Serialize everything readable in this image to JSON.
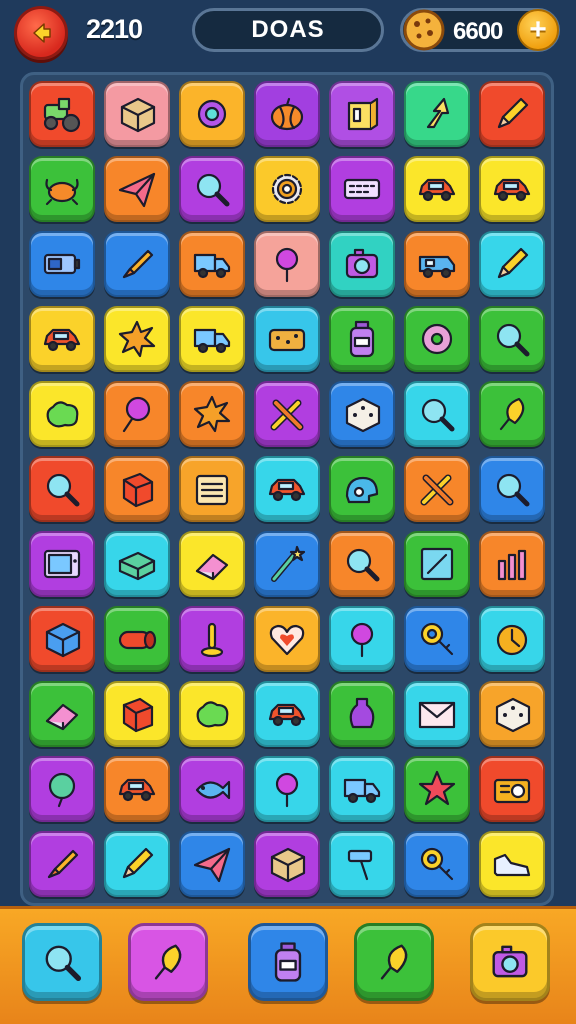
{
  "header": {
    "score": "2210",
    "title": "DOAS",
    "coins": "6600",
    "plus": "+"
  },
  "board": {
    "rows": [
      [
        {
          "color": "#f04a2c",
          "icon": "tractor-icon"
        },
        {
          "color": "#f49aa2",
          "icon": "box-icon"
        },
        {
          "color": "#fbb42a",
          "icon": "ring-icon"
        },
        {
          "color": "#a23fe0",
          "icon": "pumpkin-icon"
        },
        {
          "color": "#b04fe4",
          "icon": "book-box-icon"
        },
        {
          "color": "#37d88a",
          "icon": "arrow-icon"
        },
        {
          "color": "#f04a2c",
          "icon": "pencil-icon"
        }
      ],
      [
        {
          "color": "#3cc13a",
          "icon": "crab-icon"
        },
        {
          "color": "#f7862a",
          "icon": "paper-plane-icon"
        },
        {
          "color": "#b13ee0",
          "icon": "magnifier-icon"
        },
        {
          "color": "#fbc92a",
          "icon": "gear-icon"
        },
        {
          "color": "#b13ee0",
          "icon": "keyboard-icon"
        },
        {
          "color": "#fbe62a",
          "icon": "car-icon"
        },
        {
          "color": "#fbe62a",
          "icon": "car-icon"
        }
      ],
      [
        {
          "color": "#2f86e8",
          "icon": "battery-icon"
        },
        {
          "color": "#2f86e8",
          "icon": "crayon-icon"
        },
        {
          "color": "#f7862a",
          "icon": "truck-icon"
        },
        {
          "color": "#f5a39a",
          "icon": "pin-icon"
        },
        {
          "color": "#31d2c2",
          "icon": "camera-icon"
        },
        {
          "color": "#f7862a",
          "icon": "van-icon"
        },
        {
          "color": "#37d6ea",
          "icon": "pencil-icon"
        }
      ],
      [
        {
          "color": "#fbd22a",
          "icon": "car-icon"
        },
        {
          "color": "#fbe62a",
          "icon": "splash-icon"
        },
        {
          "color": "#fbe62a",
          "icon": "truck-icon"
        },
        {
          "color": "#37c6ea",
          "icon": "sponge-icon"
        },
        {
          "color": "#3cc13a",
          "icon": "bottle-icon"
        },
        {
          "color": "#3cc13a",
          "icon": "donut-icon"
        },
        {
          "color": "#3cc13a",
          "icon": "magnifier-icon"
        }
      ],
      [
        {
          "color": "#fbe62a",
          "icon": "blob-icon"
        },
        {
          "color": "#f7862a",
          "icon": "lollipop-icon"
        },
        {
          "color": "#f7862a",
          "icon": "splash-icon"
        },
        {
          "color": "#b13ee0",
          "icon": "tools-icon"
        },
        {
          "color": "#2f86e8",
          "icon": "dice-icon"
        },
        {
          "color": "#37d6ea",
          "icon": "magnifier-icon"
        },
        {
          "color": "#3cc13a",
          "icon": "brush-icon"
        }
      ],
      [
        {
          "color": "#f04a2c",
          "icon": "magnifier-icon"
        },
        {
          "color": "#f7862a",
          "icon": "cube-icon"
        },
        {
          "color": "#f7a42a",
          "icon": "notepad-icon"
        },
        {
          "color": "#37d6ea",
          "icon": "car-icon"
        },
        {
          "color": "#3cc13a",
          "icon": "helmet-icon"
        },
        {
          "color": "#f7862a",
          "icon": "tools-icon"
        },
        {
          "color": "#2f86e8",
          "icon": "magnifier-icon"
        }
      ],
      [
        {
          "color": "#b13ee0",
          "icon": "tv-icon"
        },
        {
          "color": "#37d6ea",
          "icon": "book-icon"
        },
        {
          "color": "#fbe62a",
          "icon": "eraser-icon"
        },
        {
          "color": "#2f86e8",
          "icon": "wand-icon"
        },
        {
          "color": "#f7862a",
          "icon": "magnifier-icon"
        },
        {
          "color": "#3cc13a",
          "icon": "frame-icon"
        },
        {
          "color": "#f7862a",
          "icon": "chart-icon"
        }
      ],
      [
        {
          "color": "#f04a2c",
          "icon": "gem-icon"
        },
        {
          "color": "#3cc13a",
          "icon": "pipe-icon"
        },
        {
          "color": "#b13ee0",
          "icon": "peg-icon"
        },
        {
          "color": "#fbb42a",
          "icon": "heart-icon"
        },
        {
          "color": "#37d6ea",
          "icon": "pin-icon"
        },
        {
          "color": "#2f86e8",
          "icon": "key-icon"
        },
        {
          "color": "#37d6ea",
          "icon": "clock-icon"
        }
      ],
      [
        {
          "color": "#3cc13a",
          "icon": "eraser-icon"
        },
        {
          "color": "#fbe62a",
          "icon": "cube-icon"
        },
        {
          "color": "#fbe62a",
          "icon": "blob-icon"
        },
        {
          "color": "#37d6ea",
          "icon": "car-icon"
        },
        {
          "color": "#3cc13a",
          "icon": "vase-icon"
        },
        {
          "color": "#37d6ea",
          "icon": "envelope-icon"
        },
        {
          "color": "#f7a42a",
          "icon": "dice-icon"
        }
      ],
      [
        {
          "color": "#b13ee0",
          "icon": "balloon-icon"
        },
        {
          "color": "#f7862a",
          "icon": "car-icon"
        },
        {
          "color": "#b13ee0",
          "icon": "fish-icon"
        },
        {
          "color": "#37d6ea",
          "icon": "pin-icon"
        },
        {
          "color": "#37d6ea",
          "icon": "truck-icon"
        },
        {
          "color": "#3cc13a",
          "icon": "star-icon"
        },
        {
          "color": "#f04a2c",
          "icon": "radio-icon"
        }
      ],
      [
        {
          "color": "#b13ee0",
          "icon": "crayon-icon"
        },
        {
          "color": "#37d6ea",
          "icon": "pencil-icon"
        },
        {
          "color": "#2f86e8",
          "icon": "paper-plane-icon"
        },
        {
          "color": "#b13ee0",
          "icon": "box-icon"
        },
        {
          "color": "#37d6ea",
          "icon": "hammer-icon"
        },
        {
          "color": "#2f86e8",
          "icon": "key-icon"
        },
        {
          "color": "#fbe62a",
          "icon": "shoe-icon"
        }
      ]
    ]
  },
  "tools": [
    {
      "color": "#37c6ea",
      "icon": "magnifier-icon"
    },
    {
      "color": "#d855e4",
      "icon": "brush-icon"
    },
    {
      "color": "#2f86e8",
      "icon": "bottle-icon"
    },
    {
      "color": "#3cc13a",
      "icon": "brush-icon"
    },
    {
      "color": "#fbc92a",
      "icon": "camera-icon"
    }
  ]
}
